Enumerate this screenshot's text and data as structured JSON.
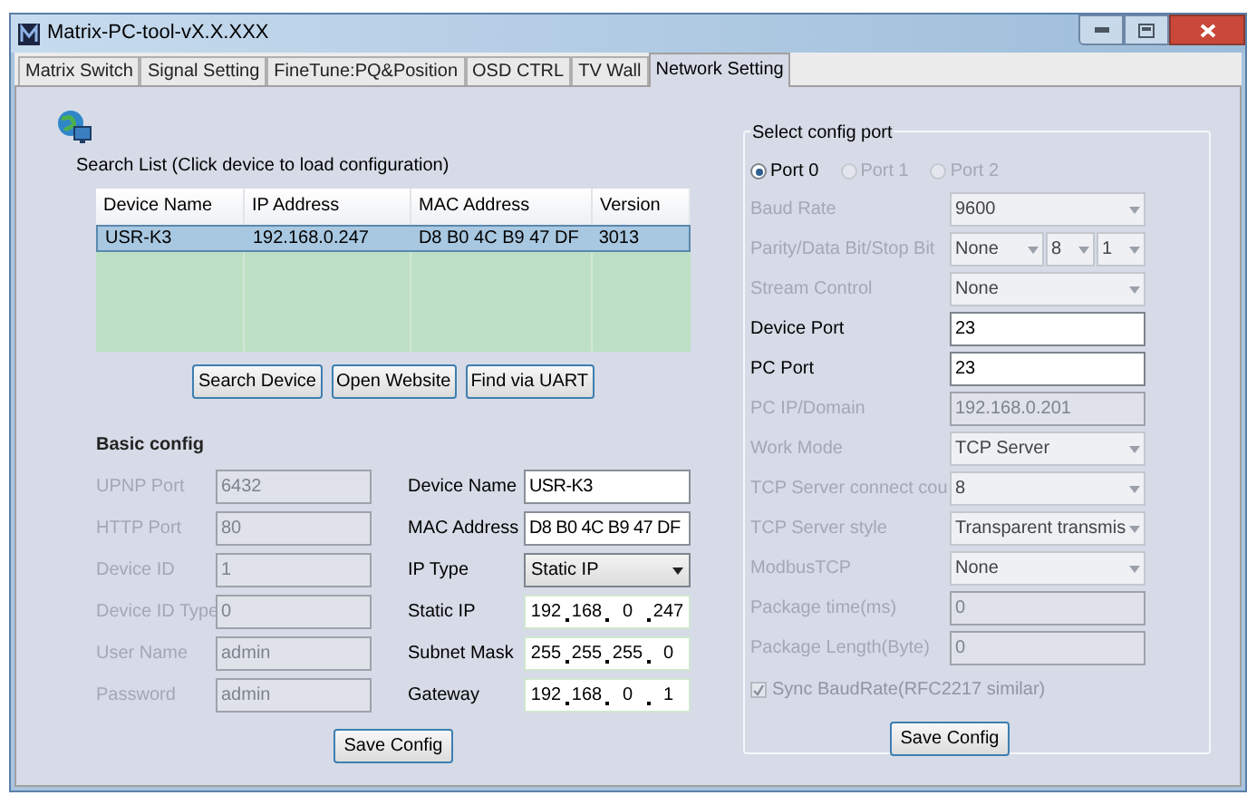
{
  "window": {
    "title": "Matrix-PC-tool-vX.X.XXX"
  },
  "tabs": [
    {
      "label": "Matrix Switch",
      "selected": false
    },
    {
      "label": "Signal Setting",
      "selected": false
    },
    {
      "label": "FineTune:PQ&Position",
      "selected": false
    },
    {
      "label": "OSD CTRL",
      "selected": false
    },
    {
      "label": "TV Wall",
      "selected": false
    },
    {
      "label": "Network Setting",
      "selected": true
    }
  ],
  "search_list": {
    "title": "Search List (Click device to load configuration)",
    "columns": [
      "Device Name",
      "IP Address",
      "MAC Address",
      "Version"
    ],
    "rows": [
      {
        "cells": [
          "USR-K3",
          "192.168.0.247",
          "D8 B0 4C B9 47 DF",
          "3013"
        ],
        "selected": true
      }
    ],
    "buttons": [
      "Search Device",
      "Open Website",
      "Find via UART"
    ]
  },
  "basic_config": {
    "title": "Basic config",
    "left_fields": [
      {
        "label": "UPNP Port",
        "value": "6432",
        "disabled": true
      },
      {
        "label": "HTTP Port",
        "value": "80",
        "disabled": true
      },
      {
        "label": "Device ID",
        "value": "1",
        "disabled": true
      },
      {
        "label": "Device ID Type",
        "value": "0",
        "disabled": true
      },
      {
        "label": "User Name",
        "value": "admin",
        "disabled": true
      },
      {
        "label": "Password",
        "value": "admin",
        "disabled": true
      }
    ],
    "right_fields": [
      {
        "label": "Device Name",
        "kind": "text",
        "value": "USR-K3"
      },
      {
        "label": "MAC Address",
        "kind": "text",
        "value": "D8 B0 4C B9 47 DF"
      },
      {
        "label": "IP Type",
        "kind": "select",
        "value": "Static IP"
      },
      {
        "label": "Static IP",
        "kind": "ip",
        "octets": [
          "192",
          "168",
          "0",
          "247"
        ]
      },
      {
        "label": "Subnet Mask",
        "kind": "ip",
        "octets": [
          "255",
          "255",
          "255",
          "0"
        ]
      },
      {
        "label": "Gateway",
        "kind": "ip",
        "octets": [
          "192",
          "168",
          "0",
          "1"
        ]
      }
    ],
    "save_button": "Save Config"
  },
  "config_port": {
    "title": "Select config port",
    "ports": [
      {
        "label": "Port 0",
        "selected": true,
        "disabled": false
      },
      {
        "label": "Port 1",
        "selected": false,
        "disabled": true
      },
      {
        "label": "Port 2",
        "selected": false,
        "disabled": true
      }
    ],
    "rows": [
      {
        "label": "Baud Rate",
        "kind": "select",
        "values": [
          "9600"
        ],
        "disabled": true
      },
      {
        "label": "Parity/Data Bit/Stop Bit",
        "kind": "select",
        "values": [
          "None",
          "8",
          "1"
        ],
        "disabled": true
      },
      {
        "label": "Stream Control",
        "kind": "select",
        "values": [
          "None"
        ],
        "disabled": true
      },
      {
        "label": "Device Port",
        "kind": "text",
        "value": "23",
        "disabled": false
      },
      {
        "label": "PC Port",
        "kind": "text",
        "value": "23",
        "disabled": false
      },
      {
        "label": "PC IP/Domain",
        "kind": "text",
        "value": "192.168.0.201",
        "disabled": true
      },
      {
        "label": "Work Mode",
        "kind": "select",
        "values": [
          "TCP Server"
        ],
        "disabled": true
      },
      {
        "label": "TCP Server connect cou",
        "kind": "select",
        "values": [
          "8"
        ],
        "disabled": true
      },
      {
        "label": "TCP Server style",
        "kind": "select",
        "values": [
          "Transparent transmis"
        ],
        "disabled": true
      },
      {
        "label": "ModbusTCP",
        "kind": "select",
        "values": [
          "None"
        ],
        "disabled": true
      },
      {
        "label": "Package time(ms)",
        "kind": "text",
        "value": "0",
        "disabled": true
      },
      {
        "label": "Package Length(Byte)",
        "kind": "text",
        "value": "0",
        "disabled": true
      }
    ],
    "sync": {
      "label": "Sync BaudRate(RFC2217 similar)",
      "checked": true,
      "disabled": true
    },
    "save_button": "Save Config"
  }
}
